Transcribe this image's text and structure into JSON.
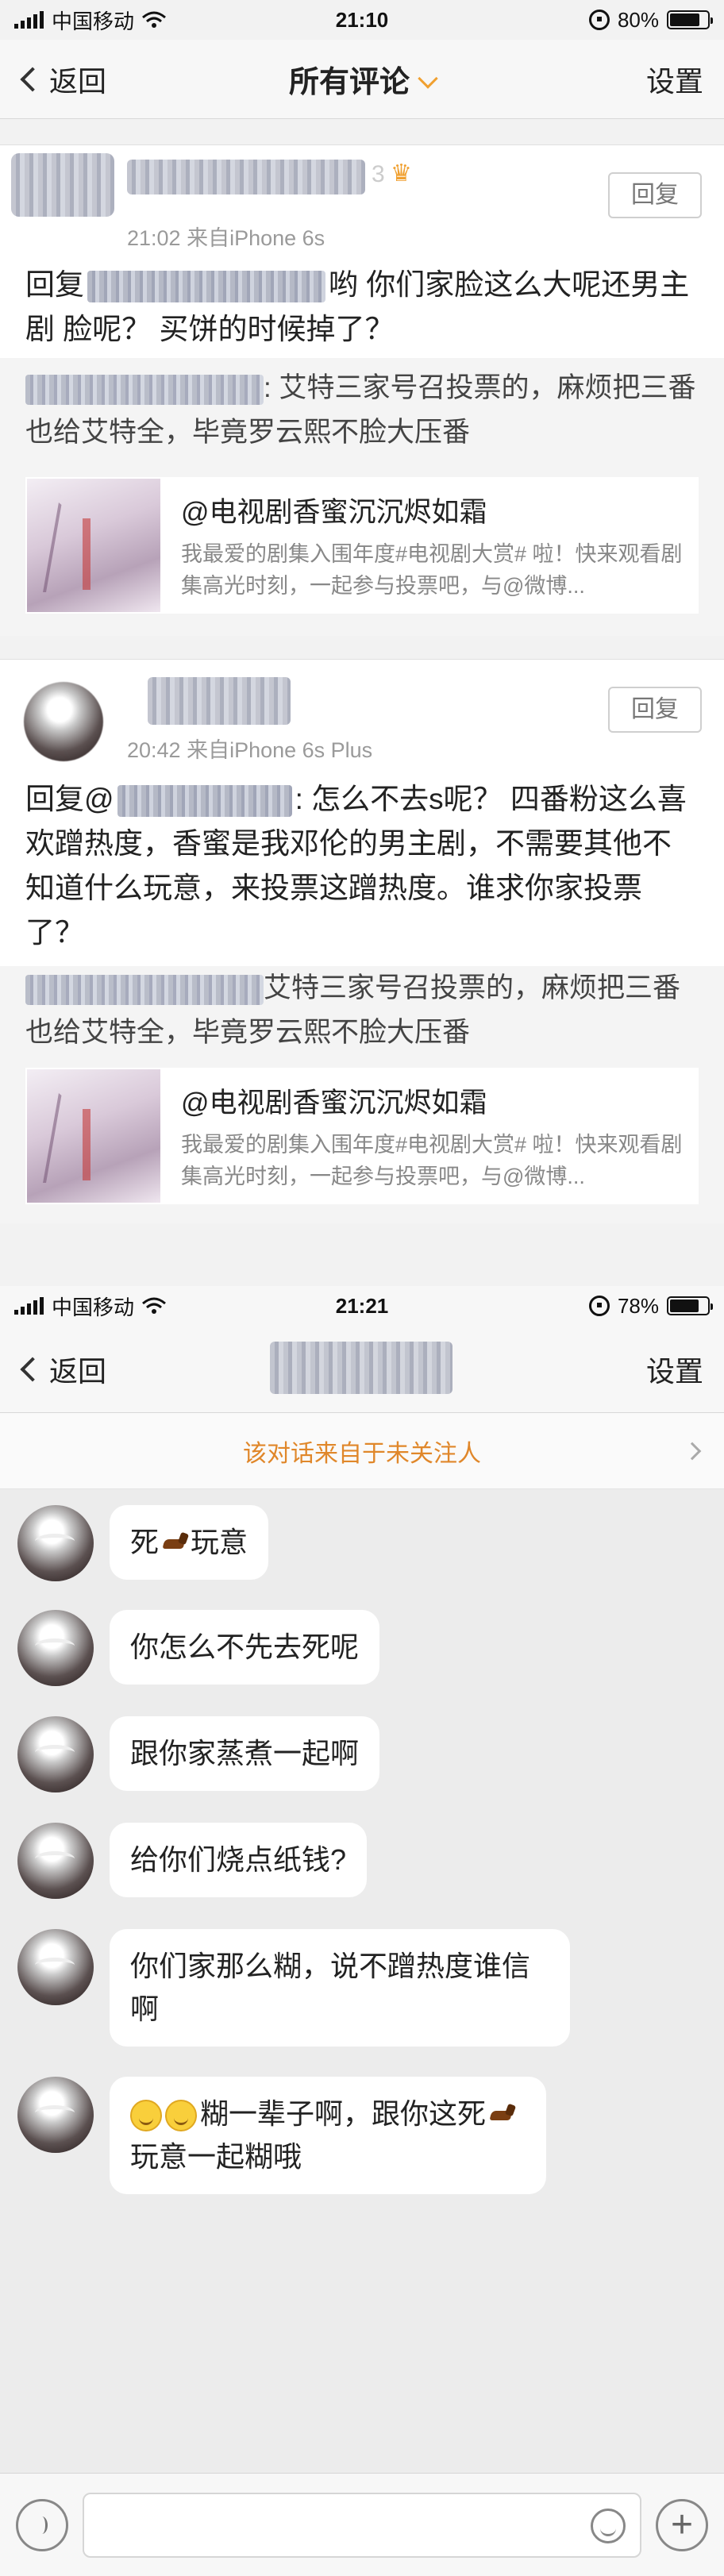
{
  "top": {
    "status": {
      "carrier": "中国移动",
      "time": "21:10",
      "battery": "80%",
      "battery_level": 0.8
    },
    "nav": {
      "back_label": "返回",
      "title": "所有评论",
      "settings_label": "设置"
    },
    "comments": [
      {
        "user_suffix": "3",
        "meta": "21:02  来自iPhone 6s",
        "reply_label": "回复",
        "text_prefix": "回复",
        "text_body": "哟  你们家脸这么大呢还男主剧 脸呢？ 买饼的时候掉了？",
        "quote_body": ": 艾特三家号召投票的，麻烦把三番也给艾特全，毕竟罗云熙不脸大压番",
        "share_title": "@电视剧香蜜沉沉烬如霜",
        "share_desc": "我最爱的剧集入围年度#电视剧大赏# 啦！快来观看剧集高光时刻，一起参与投票吧，与@微博..."
      },
      {
        "meta": "20:42  来自iPhone 6s Plus",
        "reply_label": "回复",
        "text_prefix": "回复@",
        "text_body": ": 怎么不去s呢？  四番粉这么喜欢蹭热度，香蜜是我邓伦的男主剧，不需要其他不知道什么玩意，来投票这蹭热度。谁求你家投票了？",
        "quote_body": "艾特三家号召投票的，麻烦把三番也给艾特全，毕竟罗云熙不脸大压番",
        "share_title": "@电视剧香蜜沉沉烬如霜",
        "share_desc": "我最爱的剧集入围年度#电视剧大赏# 啦！快来观看剧集高光时刻，一起参与投票吧，与@微博..."
      }
    ]
  },
  "bottom": {
    "status": {
      "carrier": "中国移动",
      "time": "21:21",
      "battery": "78%",
      "battery_level": 0.78
    },
    "nav": {
      "back_label": "返回",
      "settings_label": "设置"
    },
    "system_notice": "该对话来自于未关注人",
    "messages": [
      {
        "before": "死",
        "after": "玩意"
      },
      {
        "text": "你怎么不先去死呢"
      },
      {
        "text": "跟你家蒸煮一起啊"
      },
      {
        "text": "给你们烧点纸钱?"
      },
      {
        "text": "你们家那么糊，说不蹭热度谁信啊"
      },
      {
        "before": "糊一辈子啊，跟你这死",
        "after": "玩意一起糊哦"
      }
    ],
    "input": {
      "placeholder": ""
    }
  },
  "icons": [
    "signal-icon",
    "wifi-icon",
    "rotation-lock-icon",
    "battery-icon",
    "back-chevron-icon",
    "dropdown-chevron-icon",
    "voice-icon",
    "emoji-icon",
    "plus-icon",
    "horse-emoji-icon",
    "smile-emoji-icon"
  ],
  "colors": {
    "accent": "#f0a030",
    "notice": "#e0872a",
    "chat_bg": "#ececec",
    "bubble": "#ffffff"
  }
}
